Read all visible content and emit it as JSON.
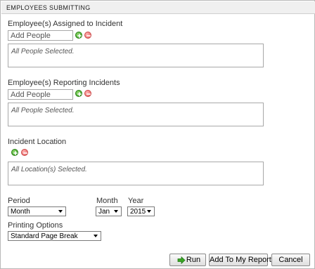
{
  "header": {
    "title": "EMPLOYEES SUBMITTING"
  },
  "assigned": {
    "label": "Employee(s) Assigned to Incident",
    "add_value": "Add People",
    "selection_text": "All People Selected."
  },
  "reporting": {
    "label": "Employee(s) Reporting Incidents",
    "add_value": "Add People",
    "selection_text": "All People Selected."
  },
  "location": {
    "label": "Incident Location",
    "selection_text": "All Location(s) Selected."
  },
  "period": {
    "label": "Period",
    "selected": "Month"
  },
  "month": {
    "label": "Month",
    "selected": "Jan"
  },
  "year": {
    "label": "Year",
    "selected": "2015"
  },
  "printing": {
    "label": "Printing Options",
    "selected": "Standard Page Break"
  },
  "buttons": {
    "run": "Run",
    "add_to_reports": "Add To My Reports",
    "cancel": "Cancel"
  },
  "colors": {
    "add_icon": "#3aa523",
    "remove_icon": "#e25b5b",
    "header_bg": "#f0f0f0"
  },
  "icons": {
    "add": "plus-circle-icon",
    "remove": "minus-circle-icon",
    "run": "green-arrow-right-icon",
    "dropdown": "chevron-down-icon"
  }
}
